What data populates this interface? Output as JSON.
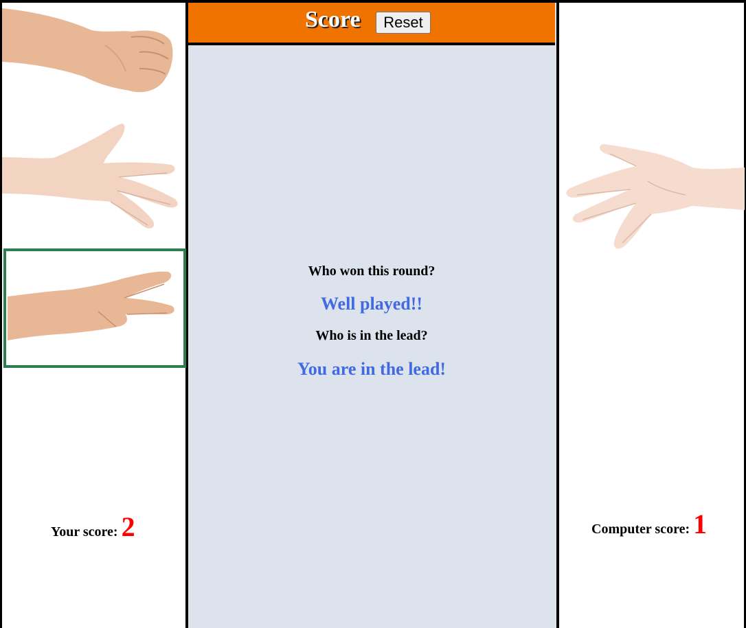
{
  "header": {
    "title": "Score",
    "reset_label": "Reset"
  },
  "round": {
    "question": "Who won this round?",
    "answer": "Well played!!"
  },
  "lead": {
    "question": "Who is in the lead?",
    "answer": "You are in the lead!"
  },
  "player": {
    "score_label": "Your score:",
    "score": "2",
    "choices": [
      "rock-icon",
      "paper-icon",
      "scissors-icon"
    ],
    "selected": "scissors"
  },
  "computer": {
    "score_label": "Computer score:",
    "score": "1",
    "choice": "paper-icon"
  },
  "colors": {
    "header": "#f07300",
    "center_bg": "#dce3ed",
    "answer_text": "#4169e1",
    "score_number": "#ff0000",
    "selection_border": "#2e7d4f"
  }
}
